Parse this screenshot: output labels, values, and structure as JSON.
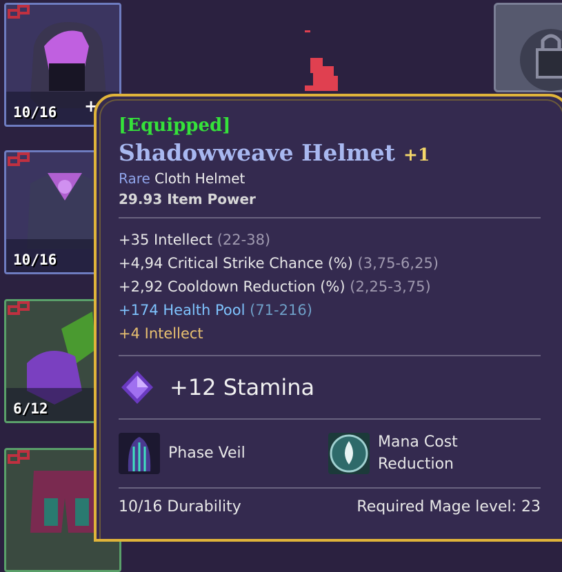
{
  "inventory": {
    "slots": [
      {
        "count": "10/16"
      },
      {
        "count": "10/16"
      },
      {
        "count": "6/12"
      },
      {
        "count": ""
      }
    ],
    "add_symbol": "+"
  },
  "tooltip": {
    "status": "[Equipped]",
    "item_name": "Shadowweave Helmet",
    "upgrade": "+1",
    "rarity": "Rare",
    "type": "Cloth Helmet",
    "item_power": "29.93 Item Power",
    "stats": [
      {
        "value": "+35 Intellect",
        "range": "(22-38)"
      },
      {
        "value": "+4,94 Critical Strike Chance (%)",
        "range": "(3,75-6,25)"
      },
      {
        "value": "+2,92 Cooldown Reduction (%)",
        "range": "(2,25-3,75)"
      },
      {
        "value": "+174 Health Pool",
        "range": "(71-216)"
      },
      {
        "value": "+4 Intellect",
        "range": ""
      }
    ],
    "gem": {
      "label": "+12 Stamina",
      "icon": "purple-gem-icon"
    },
    "abilities": [
      {
        "label": "Phase Veil",
        "icon": "phase-veil-icon"
      },
      {
        "label_line1": "Mana Cost",
        "label_line2": "Reduction",
        "icon": "mana-cost-reduction-icon"
      }
    ],
    "durability": "10/16 Durability",
    "requirement": "Required Mage level: 23"
  },
  "colors": {
    "background": "#2b2140",
    "tooltip_border": "#e0b43a",
    "equipped": "#35e23a",
    "item_name": "#a8b8f0",
    "rare": "#8fa4ea",
    "health_stat": "#7fc4ff",
    "bonus_stat": "#e8c070"
  }
}
